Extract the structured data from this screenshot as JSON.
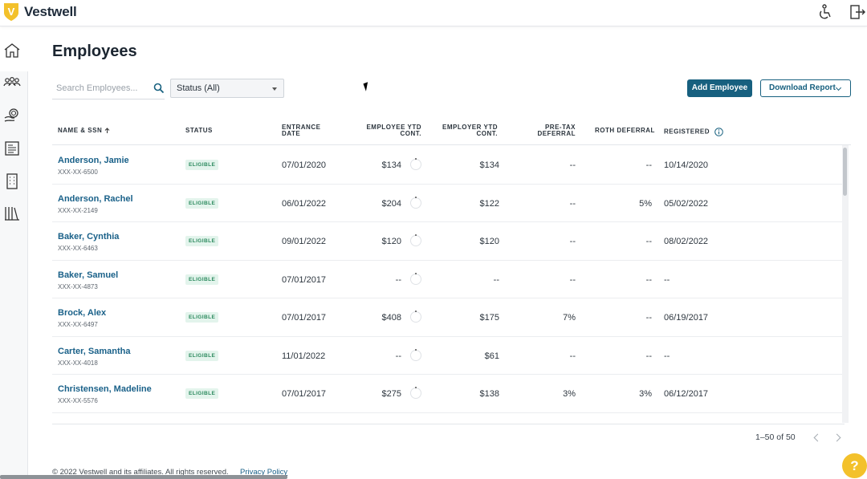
{
  "app": {
    "brand": "Vestwell",
    "logo_letter": "V"
  },
  "colors": {
    "primary": "#17607f",
    "brand_gold": "#f3c12b",
    "link": "#1a6189",
    "eligible_bg": "#e3f4ec",
    "eligible_fg": "#2c8a5e"
  },
  "top_icons": [
    "accessibility-icon",
    "logout-icon"
  ],
  "sidebar": {
    "items": [
      "home-icon",
      "people-icon",
      "hand-coins-icon",
      "document-icon",
      "building-icon",
      "library-icon"
    ]
  },
  "page": {
    "title": "Employees"
  },
  "search": {
    "placeholder": "Search Employees..."
  },
  "status_filter": {
    "value": "Status (All)"
  },
  "buttons": {
    "add": "Add Employee",
    "download": "Download Report"
  },
  "table": {
    "headers": {
      "name": "NAME & SSN",
      "status": "STATUS",
      "entrance_1": "ENTRANCE",
      "entrance_2": "DATE",
      "emp_ytd_1": "EMPLOYEE YTD",
      "emp_ytd_2": "CONT.",
      "er_ytd_1": "EMPLOYER YTD",
      "er_ytd_2": "CONT.",
      "pretax_1": "PRE-TAX",
      "pretax_2": "DEFERRAL",
      "roth": "ROTH DEFERRAL",
      "registered": "REGISTERED"
    },
    "rows": [
      {
        "name": "Anderson, Jamie",
        "ssn": "XXX-XX-6500",
        "status": "ELIGIBLE",
        "entrance": "07/01/2020",
        "employee_ytd": "$134",
        "employer_ytd": "$134",
        "pretax": "--",
        "roth": "--",
        "registered": "10/14/2020"
      },
      {
        "name": "Anderson, Rachel",
        "ssn": "XXX-XX-2149",
        "status": "ELIGIBLE",
        "entrance": "06/01/2022",
        "employee_ytd": "$204",
        "employer_ytd": "$122",
        "pretax": "--",
        "roth": "5%",
        "registered": "05/02/2022"
      },
      {
        "name": "Baker, Cynthia",
        "ssn": "XXX-XX-6463",
        "status": "ELIGIBLE",
        "entrance": "09/01/2022",
        "employee_ytd": "$120",
        "employer_ytd": "$120",
        "pretax": "--",
        "roth": "--",
        "registered": "08/02/2022"
      },
      {
        "name": "Baker, Samuel",
        "ssn": "XXX-XX-4873",
        "status": "ELIGIBLE",
        "entrance": "07/01/2017",
        "employee_ytd": "--",
        "employer_ytd": "--",
        "pretax": "--",
        "roth": "--",
        "registered": "--"
      },
      {
        "name": "Brock, Alex",
        "ssn": "XXX-XX-6497",
        "status": "ELIGIBLE",
        "entrance": "07/01/2017",
        "employee_ytd": "$408",
        "employer_ytd": "$175",
        "pretax": "7%",
        "roth": "--",
        "registered": "06/19/2017"
      },
      {
        "name": "Carter, Samantha",
        "ssn": "XXX-XX-4018",
        "status": "ELIGIBLE",
        "entrance": "11/01/2022",
        "employee_ytd": "--",
        "employer_ytd": "$61",
        "pretax": "--",
        "roth": "--",
        "registered": "--"
      },
      {
        "name": "Christensen, Madeline",
        "ssn": "XXX-XX-5576",
        "status": "ELIGIBLE",
        "entrance": "07/01/2017",
        "employee_ytd": "$275",
        "employer_ytd": "$138",
        "pretax": "3%",
        "roth": "3%",
        "registered": "06/12/2017"
      }
    ]
  },
  "pagination": {
    "range": "1–50 of 50"
  },
  "footer": {
    "copyright": "© 2022 Vestwell and its affiliates. All rights reserved.",
    "privacy": "Privacy Policy"
  },
  "help": {
    "label": "?"
  }
}
